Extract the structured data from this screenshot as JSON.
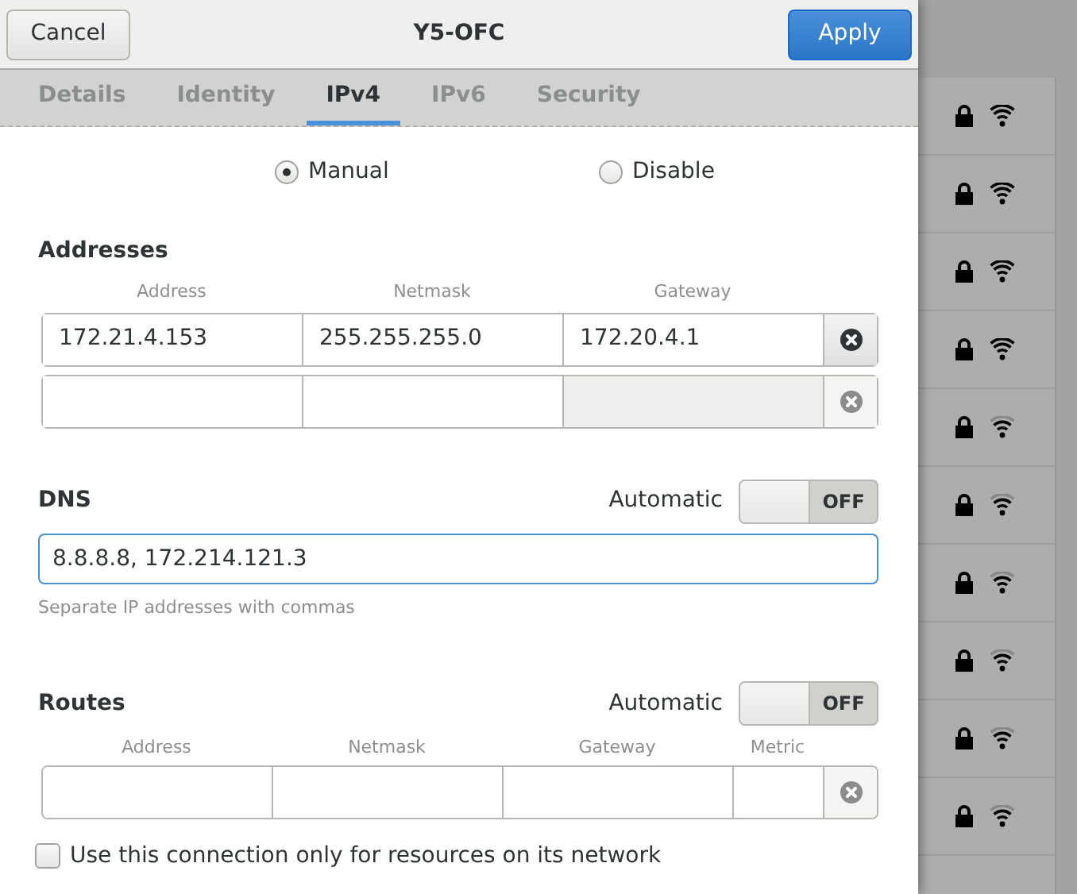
{
  "header": {
    "cancel": "Cancel",
    "title": "Y5-OFC",
    "apply": "Apply"
  },
  "tabs": [
    {
      "label": "Details",
      "selected": false
    },
    {
      "label": "Identity",
      "selected": false
    },
    {
      "label": "IPv4",
      "selected": true
    },
    {
      "label": "IPv6",
      "selected": false
    },
    {
      "label": "Security",
      "selected": false
    }
  ],
  "method_options": [
    {
      "label": "Manual",
      "selected": true
    },
    {
      "label": "Disable",
      "selected": false
    }
  ],
  "addresses": {
    "heading": "Addresses",
    "columns": [
      "Address",
      "Netmask",
      "Gateway"
    ],
    "rows": [
      {
        "values": [
          "172.21.4.153",
          "255.255.255.0",
          "172.20.4.1"
        ],
        "disabled": false
      },
      {
        "disabled": true
      }
    ]
  },
  "dns": {
    "heading": "DNS",
    "automatic_label": "Automatic",
    "automatic_on": false,
    "switch_text": "OFF",
    "value": "8.8.8.8, 172.214.121.3",
    "hint": "Separate IP addresses with commas"
  },
  "routes": {
    "heading": "Routes",
    "automatic_label": "Automatic",
    "automatic_on": false,
    "switch_text": "OFF",
    "columns": [
      "Address",
      "Netmask",
      "Gateway",
      "Metric"
    ]
  },
  "only_local": {
    "label": "Use this connection only for resources on its network",
    "checked": false
  },
  "background_networks": [
    {
      "kind": "strong"
    },
    {
      "kind": "strong"
    },
    {
      "kind": "strong"
    },
    {
      "kind": "strong"
    },
    {
      "kind": "medium"
    },
    {
      "kind": "medium"
    },
    {
      "kind": "medium"
    },
    {
      "kind": "medium"
    },
    {
      "kind": "medium"
    },
    {
      "kind": "medium"
    }
  ]
}
